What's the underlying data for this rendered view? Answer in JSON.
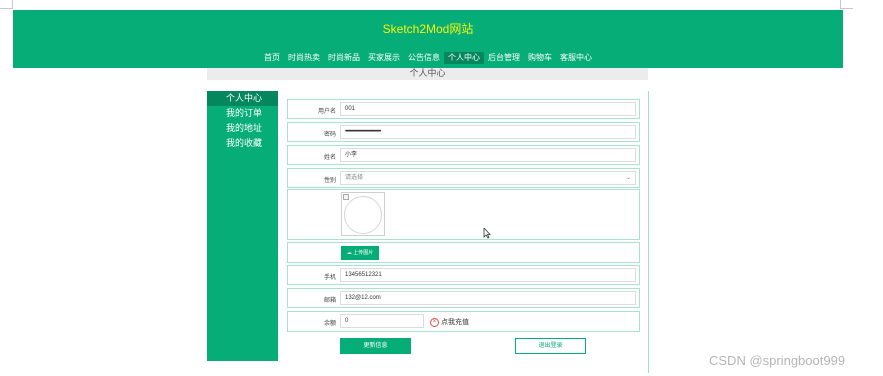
{
  "site": {
    "title": "Sketch2Mod网站"
  },
  "nav": [
    {
      "label": "首页",
      "active": false
    },
    {
      "label": "时尚热卖",
      "active": false
    },
    {
      "label": "时尚新品",
      "active": false
    },
    {
      "label": "买家展示",
      "active": false
    },
    {
      "label": "公告信息",
      "active": false
    },
    {
      "label": "个人中心",
      "active": true
    },
    {
      "label": "后台管理",
      "active": false
    },
    {
      "label": "购物车",
      "active": false
    },
    {
      "label": "客服中心",
      "active": false
    }
  ],
  "page_heading": "个人中心",
  "sidebar": {
    "items": [
      {
        "label": "个人中心",
        "active": true
      },
      {
        "label": "我的订单",
        "active": false
      },
      {
        "label": "我的地址",
        "active": false
      },
      {
        "label": "我的收藏",
        "active": false
      }
    ]
  },
  "form": {
    "username": {
      "label": "用户名",
      "value": "001"
    },
    "password": {
      "label": "密码",
      "value": "••••••••••••••••••••••••••••••••"
    },
    "name": {
      "label": "姓名",
      "value": "小李"
    },
    "gender": {
      "label": "性别",
      "placeholder": "请选择"
    },
    "upload_label": "上传图片",
    "phone": {
      "label": "手机",
      "value": "13456512321"
    },
    "email": {
      "label": "邮箱",
      "value": "132@12.com"
    },
    "balance": {
      "label": "余额",
      "value": "0"
    },
    "recharge_label": "点我充值"
  },
  "actions": {
    "update": "更新信息",
    "logout": "退出登录"
  },
  "watermark": "CSDN @springboot999",
  "colors": {
    "primary": "#06ad77",
    "primary_dark": "#04875c",
    "title": "#f4f40d",
    "recharge_icon": "#e24c4c"
  }
}
